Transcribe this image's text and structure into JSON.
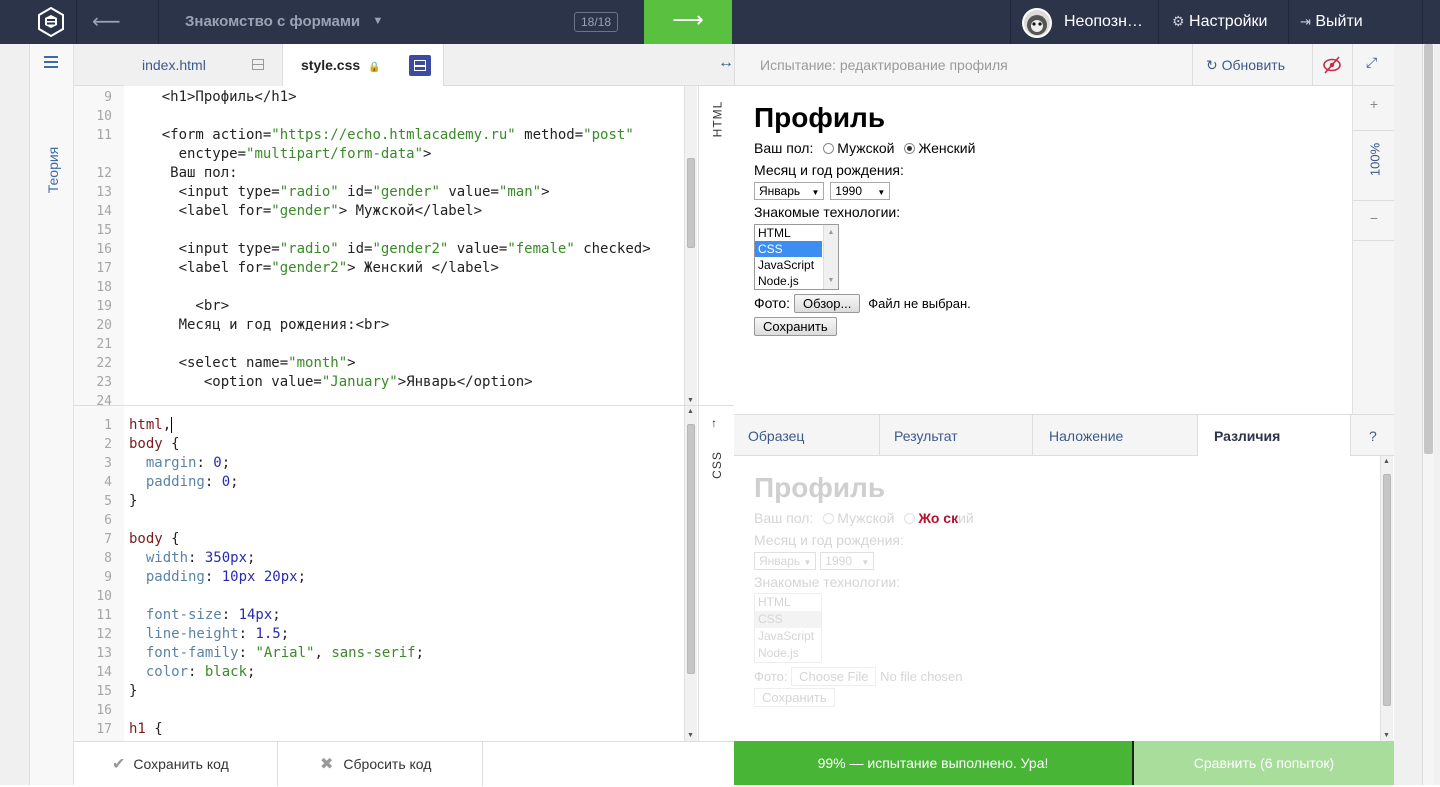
{
  "topbar": {
    "back_arrow": "⟵",
    "course_title": "Знакомство с формами",
    "course_dropdown_icon": "chevron-down-icon",
    "counter": "18/18",
    "next_arrow": "⟶",
    "user_name": "Неопозн…",
    "settings_label": "Настройки",
    "logout_label": "Выйти"
  },
  "sidebar": {
    "theory_label": "Теория",
    "menu_icon": "hamburger-icon"
  },
  "editor_tabs": [
    {
      "label": "index.html"
    },
    {
      "label": "style.css"
    }
  ],
  "html_editor": {
    "side_label": "HTML",
    "line_numbers": [
      "9",
      "10",
      "11",
      "",
      "12",
      "13",
      "14",
      "15",
      "16",
      "17",
      "18",
      "19",
      "20",
      "21",
      "22",
      "23",
      "24"
    ]
  },
  "css_editor": {
    "side_label": "CSS",
    "line_numbers": [
      "1",
      "2",
      "3",
      "4",
      "5",
      "6",
      "7",
      "8",
      "9",
      "10",
      "11",
      "12",
      "13",
      "14",
      "15",
      "16",
      "17"
    ]
  },
  "preview_bar": {
    "title": "Испытание: редактирование профиля",
    "refresh_label": "Обновить"
  },
  "zoom": {
    "plus": "+",
    "level": "100%",
    "minus": "−"
  },
  "preview": {
    "heading": "Профиль",
    "gender_label": "Ваш пол:",
    "gender_male": "Мужской",
    "gender_female": "Женский",
    "birth_label": "Месяц и год рождения:",
    "month_value": "Январь",
    "year_value": "1990",
    "tech_label": "Знакомые технологии:",
    "tech_options": [
      "HTML",
      "CSS",
      "JavaScript",
      "Node.js"
    ],
    "photo_label": "Фото:",
    "browse_button": "Обзор...",
    "no_file": "Файл не выбран.",
    "save_button": "Сохранить"
  },
  "compare_tabs": [
    {
      "label": "Образец"
    },
    {
      "label": "Результат"
    },
    {
      "label": "Наложение"
    },
    {
      "label": "Различия"
    },
    {
      "label": "?"
    }
  ],
  "diff": {
    "heading": "Профиль",
    "gender_label": "Ваш пол:",
    "gender_male": "Мужской",
    "gender_female_highlight": "Жо ск",
    "gender_female_rest": "ий",
    "birth_label": "Месяц и год рождения:",
    "month_value": "Январь",
    "year_value": "1990",
    "tech_label": "Знакомые технологии:",
    "tech_options": [
      "HTML",
      "CSS",
      "JavaScript",
      "Node.js"
    ],
    "photo_label": "Фото:",
    "choose_file": "Choose File",
    "no_file": "No file chosen",
    "save_button": "Сохранить"
  },
  "bottom": {
    "save_code": "Сохранить код",
    "reset_code": "Сбросить код",
    "status": "99% — испытание выполнено. Ура!",
    "compare": "Сравнить (6 попыток)"
  },
  "colors": {
    "accent_green": "#48b536",
    "topbar": "#2b3448",
    "link_blue": "#3c5a8a",
    "diff_red": "#b3102a"
  }
}
